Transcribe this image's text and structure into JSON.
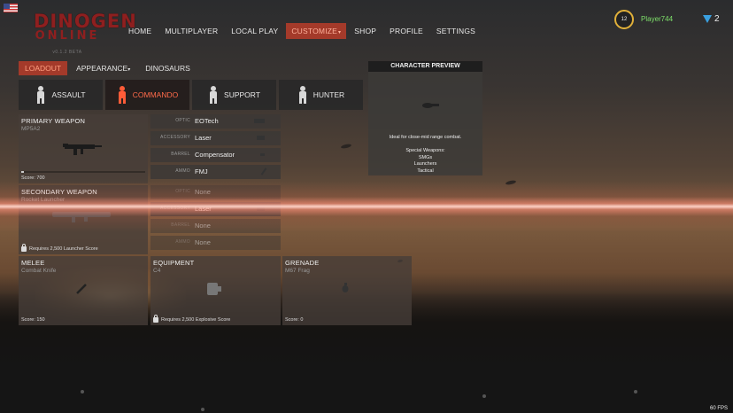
{
  "header": {
    "logo_line1": "DINOGEN",
    "logo_line2": "ONLINE",
    "version": "v0.1.2 BETA",
    "nav": [
      {
        "label": "HOME",
        "caret": ""
      },
      {
        "label": "MULTIPLAYER",
        "caret": ""
      },
      {
        "label": "LOCAL PLAY",
        "caret": ""
      },
      {
        "label": "CUSTOMIZE",
        "caret": "▾"
      },
      {
        "label": "SHOP",
        "caret": ""
      },
      {
        "label": "PROFILE",
        "caret": ""
      },
      {
        "label": "SETTINGS",
        "caret": ""
      }
    ],
    "active_nav": "CUSTOMIZE",
    "rank": "12",
    "player_name": "Player744",
    "currency_value": "2"
  },
  "subtabs": [
    {
      "label": "LOADOUT",
      "caret": ""
    },
    {
      "label": "APPEARANCE",
      "caret": "▾"
    },
    {
      "label": "DINOSAURS",
      "caret": ""
    }
  ],
  "classes": [
    "ASSAULT",
    "COMMANDO",
    "SUPPORT",
    "HUNTER"
  ],
  "active_class": "COMMANDO",
  "primary": {
    "title": "PRIMARY WEAPON",
    "weapon": "MP5A2",
    "score": "Score: 700",
    "progress": 0.02
  },
  "secondary": {
    "title": "SECONDARY WEAPON",
    "weapon": "Rocket Launcher",
    "lock_text": "Requires 2,500 Launcher Score"
  },
  "primary_attachments": [
    {
      "key": "OPTIC",
      "value": "EOTech"
    },
    {
      "key": "ACCESSORY",
      "value": "Laser"
    },
    {
      "key": "BARREL",
      "value": "Compensator"
    },
    {
      "key": "AMMO",
      "value": "FMJ"
    }
  ],
  "secondary_attachments": [
    {
      "key": "OPTIC",
      "value": "None"
    },
    {
      "key": "ACCESSORY",
      "value": "Laser"
    },
    {
      "key": "BARREL",
      "value": "None"
    },
    {
      "key": "AMMO",
      "value": "None"
    }
  ],
  "melee": {
    "title": "MELEE",
    "item": "Combat Knife",
    "score": "Score: 150"
  },
  "equipment": {
    "title": "EQUIPMENT",
    "item": "C4",
    "lock_text": "Requires 2,500 Explosive Score"
  },
  "grenade": {
    "title": "GRENADE",
    "item": "M67 Frag",
    "score": "Score: 0"
  },
  "preview": {
    "title": "CHARACTER PREVIEW",
    "description": "Ideal for close-mid range combat.",
    "special_label": "Special Weapons:",
    "special_items": [
      "SMGs",
      "Launchers",
      "Tactical"
    ]
  },
  "fps": "60 FPS",
  "colors": {
    "accent": "#a43a2a",
    "active_class_text": "#ff6b4a",
    "player_name": "#7ee06a",
    "rank_ring": "#e2b13a",
    "currency_icon": "#3aa0e0"
  }
}
